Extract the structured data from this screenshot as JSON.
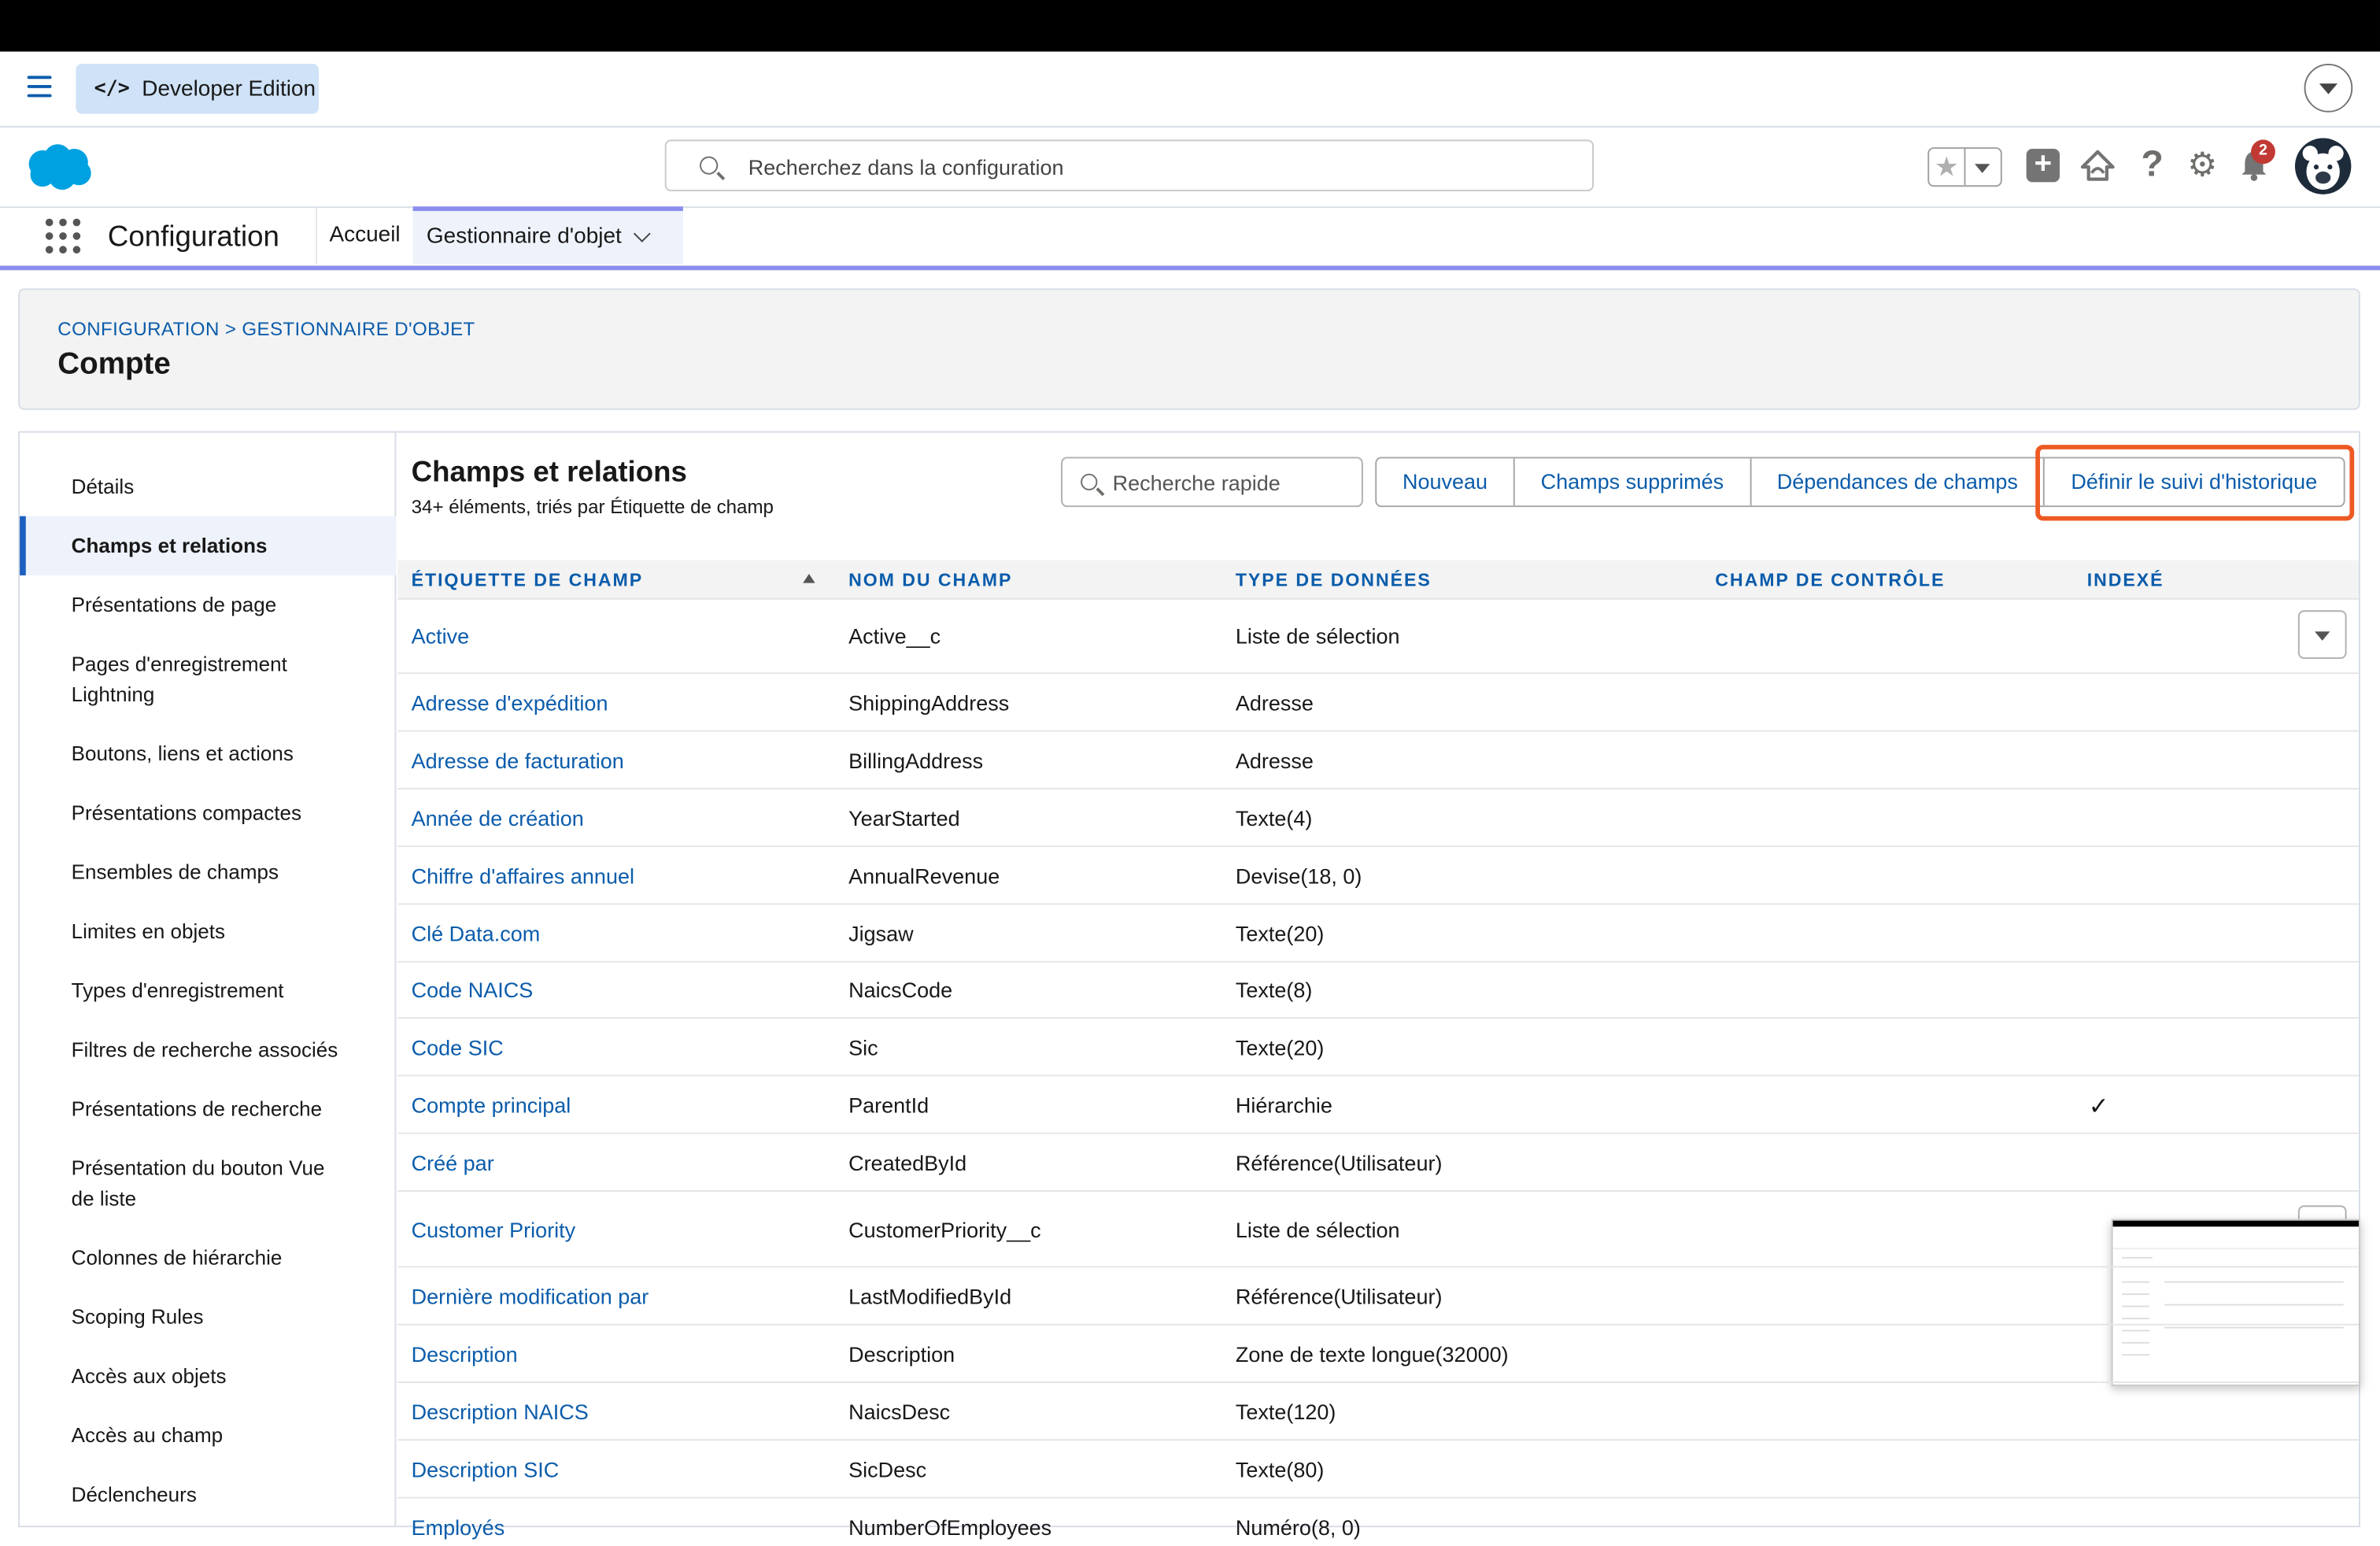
{
  "topbar": {
    "dev_label": "Developer Edition",
    "dev_icon": "code-icon"
  },
  "header": {
    "search_placeholder": "Recherchez dans la configuration",
    "notifications_count": "2",
    "help_symbol": "?"
  },
  "appnav": {
    "app_name": "Configuration",
    "tabs": [
      {
        "label": "Accueil"
      },
      {
        "label": "Gestionnaire d'objet"
      }
    ]
  },
  "page": {
    "breadcrumb": "CONFIGURATION > GESTIONNAIRE D'OBJET",
    "title": "Compte"
  },
  "sidebar": {
    "items": [
      {
        "label": "Détails"
      },
      {
        "label": "Champs et relations"
      },
      {
        "label": "Présentations de page"
      },
      {
        "label": "Pages d'enregistrement Lightning"
      },
      {
        "label": "Boutons, liens et actions"
      },
      {
        "label": "Présentations compactes"
      },
      {
        "label": "Ensembles de champs"
      },
      {
        "label": "Limites en objets"
      },
      {
        "label": "Types d'enregistrement"
      },
      {
        "label": "Filtres de recherche associés"
      },
      {
        "label": "Présentations de recherche"
      },
      {
        "label": "Présentation du bouton Vue de liste"
      },
      {
        "label": "Colonnes de hiérarchie"
      },
      {
        "label": "Scoping Rules"
      },
      {
        "label": "Accès aux objets"
      },
      {
        "label": "Accès au champ"
      },
      {
        "label": "Déclencheurs"
      }
    ]
  },
  "section": {
    "title": "Champs et relations",
    "subtitle": "34+ éléments, triés par Étiquette de champ",
    "quick_search_placeholder": "Recherche rapide",
    "buttons": {
      "new": "Nouveau",
      "deleted": "Champs supprimés",
      "dependencies": "Dépendances de champs",
      "history": "Définir le suivi d'historique"
    }
  },
  "table": {
    "headers": {
      "label": "ÉTIQUETTE DE CHAMP",
      "name": "NOM DU CHAMP",
      "type": "TYPE DE DONNÉES",
      "controlling": "CHAMP DE CONTRÔLE",
      "indexed": "INDEXÉ"
    },
    "rows": [
      {
        "label": "Active",
        "name": "Active__c",
        "type": "Liste de sélection",
        "indexed": false,
        "menu": true
      },
      {
        "label": "Adresse d'expédition",
        "name": "ShippingAddress",
        "type": "Adresse",
        "indexed": false
      },
      {
        "label": "Adresse de facturation",
        "name": "BillingAddress",
        "type": "Adresse",
        "indexed": false
      },
      {
        "label": "Année de création",
        "name": "YearStarted",
        "type": "Texte(4)",
        "indexed": false
      },
      {
        "label": "Chiffre d'affaires annuel",
        "name": "AnnualRevenue",
        "type": "Devise(18, 0)",
        "indexed": false
      },
      {
        "label": "Clé Data.com",
        "name": "Jigsaw",
        "type": "Texte(20)",
        "indexed": false
      },
      {
        "label": "Code NAICS",
        "name": "NaicsCode",
        "type": "Texte(8)",
        "indexed": false
      },
      {
        "label": "Code SIC",
        "name": "Sic",
        "type": "Texte(20)",
        "indexed": false
      },
      {
        "label": "Compte principal",
        "name": "ParentId",
        "type": "Hiérarchie",
        "indexed": true,
        "check": "✓"
      },
      {
        "label": "Créé par",
        "name": "CreatedById",
        "type": "Référence(Utilisateur)",
        "indexed": false
      },
      {
        "label": "Customer Priority",
        "name": "CustomerPriority__c",
        "type": "Liste de sélection",
        "indexed": false
      },
      {
        "label": "Dernière modification par",
        "name": "LastModifiedById",
        "type": "Référence(Utilisateur)",
        "indexed": false
      },
      {
        "label": "Description",
        "name": "Description",
        "type": "Zone de texte longue(32000)",
        "indexed": false
      },
      {
        "label": "Description NAICS",
        "name": "NaicsDesc",
        "type": "Texte(120)",
        "indexed": false
      },
      {
        "label": "Description SIC",
        "name": "SicDesc",
        "type": "Texte(80)",
        "indexed": false
      },
      {
        "label": "Employés",
        "name": "NumberOfEmployees",
        "type": "Numéro(8, 0)",
        "indexed": false
      }
    ]
  },
  "colors": {
    "brand_blue": "#0b5cab",
    "nav_accent": "#8c8dee",
    "highlight": "#ee5a24",
    "salesforce_cloud": "#00a1e0",
    "badge": "#c23934"
  }
}
